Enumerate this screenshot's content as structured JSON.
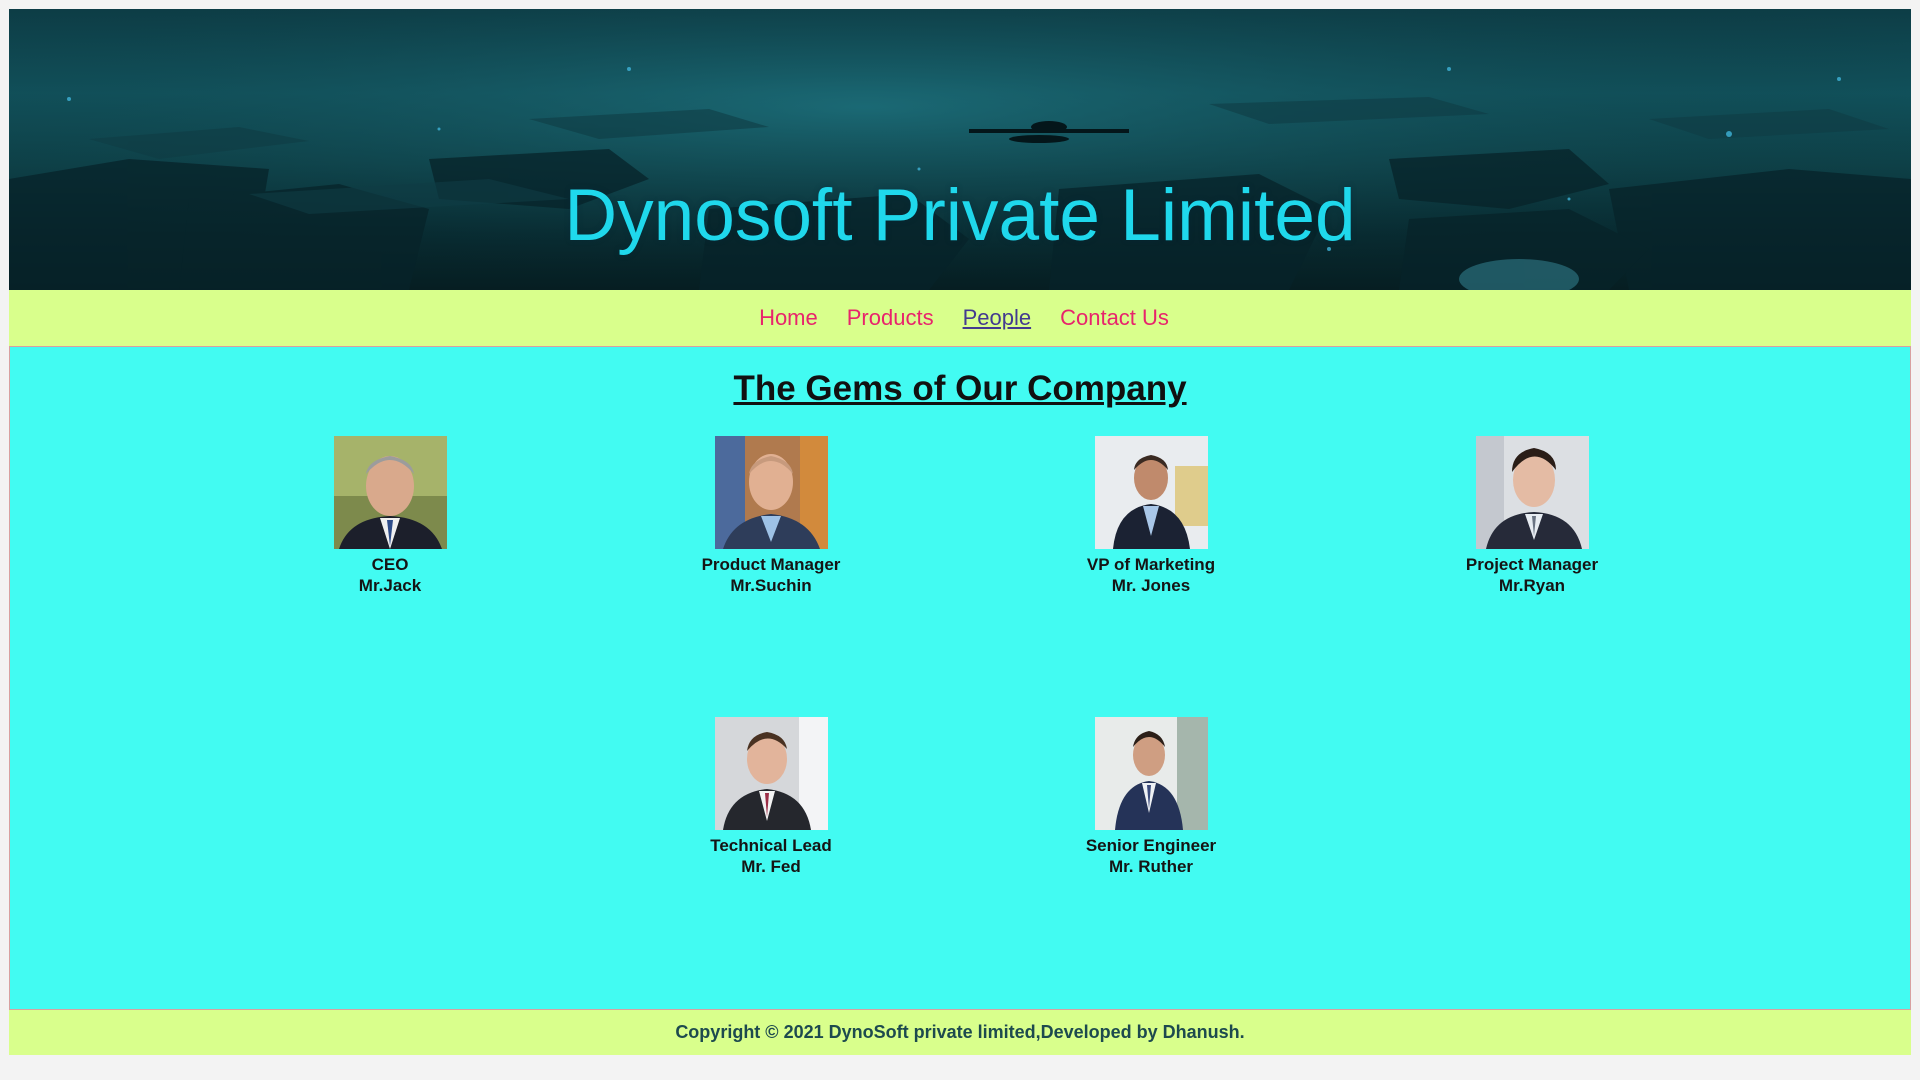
{
  "banner": {
    "title": "Dynosoft Private Limited"
  },
  "nav": {
    "items": [
      {
        "label": "Home",
        "active": false
      },
      {
        "label": "Products",
        "active": false
      },
      {
        "label": "People",
        "active": true
      },
      {
        "label": "Contact Us",
        "active": false
      }
    ]
  },
  "main": {
    "heading": "The Gems of Our Company",
    "people": [
      {
        "role": "CEO",
        "name": "Mr.Jack"
      },
      {
        "role": "Product Manager",
        "name": "Mr.Suchin"
      },
      {
        "role": "VP of Marketing",
        "name": "Mr. Jones"
      },
      {
        "role": "Project Manager",
        "name": "Mr.Ryan"
      },
      {
        "role": "Technical Lead",
        "name": "Mr. Fed"
      },
      {
        "role": "Senior Engineer",
        "name": "Mr. Ruther"
      }
    ]
  },
  "footer": {
    "text": "Copyright © 2021 DynoSoft private limited,Developed by Dhanush."
  },
  "colors": {
    "title": "#1fd8ec",
    "nav_bg": "#d9ff8c",
    "nav_link": "#e8246c",
    "nav_active": "#433a8f",
    "main_bg": "#42fbf2"
  }
}
